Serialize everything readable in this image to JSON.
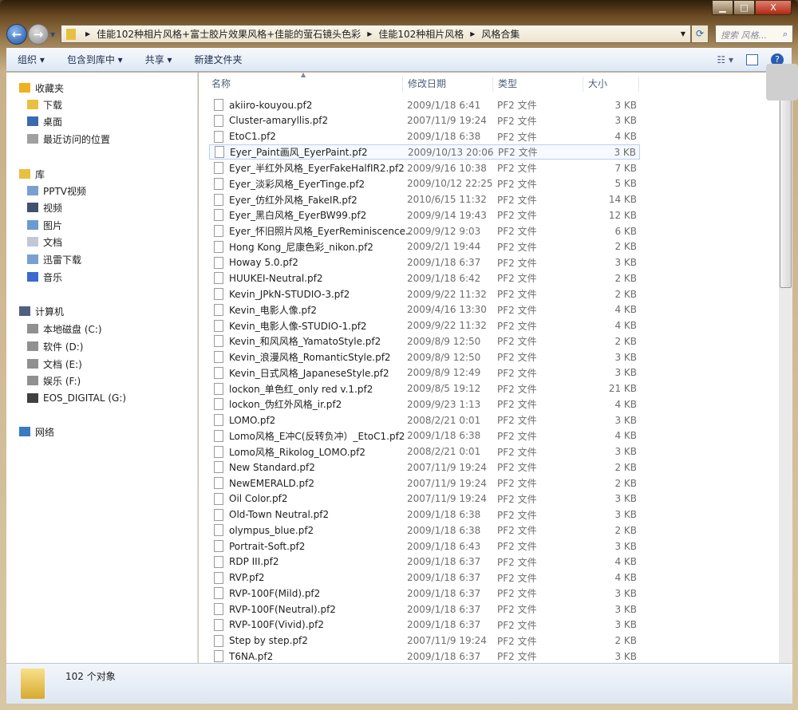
{
  "window": {
    "minimize": "▁",
    "maximize": "□",
    "close": "X"
  },
  "address": {
    "crumbs": [
      "佳能102种相片风格+富士胶片效果风格+佳能的萤石镜头色彩",
      "佳能102种相片风格",
      "风格合集"
    ],
    "search_placeholder": "搜索 风格..."
  },
  "toolbar": {
    "organize": "组织 ▾",
    "include": "包含到库中 ▾",
    "share": "共享 ▾",
    "new_folder": "新建文件夹"
  },
  "sidebar": {
    "items": [
      {
        "label": "收藏夹",
        "indent": 0,
        "color": "#f0b020"
      },
      {
        "label": "下载",
        "indent": 1,
        "color": "#e8c040"
      },
      {
        "label": "桌面",
        "indent": 1,
        "color": "#3a6ab0"
      },
      {
        "label": "最近访问的位置",
        "indent": 1,
        "color": "#a0a0a0"
      },
      {
        "label": "库",
        "indent": 0,
        "color": "#e8c040"
      },
      {
        "label": "PPTV视频",
        "indent": 1,
        "color": "#7aa0d0"
      },
      {
        "label": "视频",
        "indent": 1,
        "color": "#405070"
      },
      {
        "label": "图片",
        "indent": 1,
        "color": "#6a9ad0"
      },
      {
        "label": "文档",
        "indent": 1,
        "color": "#c0c8d8"
      },
      {
        "label": "迅雷下载",
        "indent": 1,
        "color": "#7aa0d0"
      },
      {
        "label": "音乐",
        "indent": 1,
        "color": "#3a6ad0"
      },
      {
        "label": "计算机",
        "indent": 0,
        "color": "#506080"
      },
      {
        "label": "本地磁盘 (C:)",
        "indent": 1,
        "color": "#909090"
      },
      {
        "label": "软件 (D:)",
        "indent": 1,
        "color": "#909090"
      },
      {
        "label": "文档 (E:)",
        "indent": 1,
        "color": "#909090"
      },
      {
        "label": "娱乐 (F:)",
        "indent": 1,
        "color": "#909090"
      },
      {
        "label": "EOS_DIGITAL (G:)",
        "indent": 1,
        "color": "#404040"
      },
      {
        "label": "网络",
        "indent": 0,
        "color": "#3a7ac0"
      }
    ]
  },
  "columns": {
    "name": "名称",
    "date": "修改日期",
    "type": "类型",
    "size": "大小"
  },
  "files": [
    [
      "akiiro-kouyou.pf2",
      "2009/1/18 6:41",
      "3 KB"
    ],
    [
      "Cluster-amaryllis.pf2",
      "2007/11/9 19:24",
      "3 KB"
    ],
    [
      "EtoC1.pf2",
      "2009/1/18 6:38",
      "4 KB"
    ],
    [
      "Eyer_Paint画风_EyerPaint.pf2",
      "2009/10/13 20:06",
      "3 KB"
    ],
    [
      "Eyer_半红外风格_EyerFakeHalfIR2.pf2",
      "2009/9/16 10:38",
      "7 KB"
    ],
    [
      "Eyer_淡彩风格_EyerTinge.pf2",
      "2009/10/12 22:25",
      "5 KB"
    ],
    [
      "Eyer_仿红外风格_FakeIR.pf2",
      "2010/6/15 11:32",
      "14 KB"
    ],
    [
      "Eyer_黑白风格_EyerBW99.pf2",
      "2009/9/14 19:43",
      "12 KB"
    ],
    [
      "Eyer_怀旧照片风格_EyerReminiscence....",
      "2009/9/12 9:03",
      "6 KB"
    ],
    [
      "Hong Kong_尼康色彩_nikon.pf2",
      "2009/2/1 19:44",
      "2 KB"
    ],
    [
      "Howay 5.0.pf2",
      "2009/1/18 6:37",
      "3 KB"
    ],
    [
      "HUUKEI-Neutral.pf2",
      "2009/1/18 6:42",
      "2 KB"
    ],
    [
      "Kevin_JPkN-STUDIO-3.pf2",
      "2009/9/22 11:32",
      "2 KB"
    ],
    [
      "Kevin_电影人像.pf2",
      "2009/4/16 13:30",
      "4 KB"
    ],
    [
      "Kevin_电影人像-STUDIO-1.pf2",
      "2009/9/22 11:32",
      "4 KB"
    ],
    [
      "Kevin_和风风格_YamatoStyle.pf2",
      "2009/8/9 12:50",
      "2 KB"
    ],
    [
      "Kevin_浪漫风格_RomanticStyle.pf2",
      "2009/8/9 12:50",
      "3 KB"
    ],
    [
      "Kevin_日式风格_JapaneseStyle.pf2",
      "2009/8/9 12:49",
      "3 KB"
    ],
    [
      "lockon_单色红_only red v.1.pf2",
      "2009/8/5 19:12",
      "21 KB"
    ],
    [
      "lockon_伪红外风格_ir.pf2",
      "2009/9/23 1:13",
      "4 KB"
    ],
    [
      "LOMO.pf2",
      "2008/2/21 0:01",
      "3 KB"
    ],
    [
      "Lomo风格_E冲C(反转负冲）_EtoC1.pf2",
      "2009/1/18 6:38",
      "4 KB"
    ],
    [
      "Lomo风格_Rikolog_LOMO.pf2",
      "2008/2/21 0:01",
      "3 KB"
    ],
    [
      "New Standard.pf2",
      "2007/11/9 19:24",
      "2 KB"
    ],
    [
      "NewEMERALD.pf2",
      "2007/11/9 19:24",
      "2 KB"
    ],
    [
      "Oil Color.pf2",
      "2007/11/9 19:24",
      "3 KB"
    ],
    [
      "Old-Town Neutral.pf2",
      "2009/1/18 6:38",
      "3 KB"
    ],
    [
      "olympus_blue.pf2",
      "2009/1/18 6:38",
      "2 KB"
    ],
    [
      "Portrait-Soft.pf2",
      "2009/1/18 6:43",
      "3 KB"
    ],
    [
      "RDP III.pf2",
      "2009/1/18 6:37",
      "4 KB"
    ],
    [
      "RVP.pf2",
      "2009/1/18 6:37",
      "4 KB"
    ],
    [
      "RVP-100F(Mild).pf2",
      "2009/1/18 6:37",
      "3 KB"
    ],
    [
      "RVP-100F(Neutral).pf2",
      "2009/1/18 6:37",
      "3 KB"
    ],
    [
      "RVP-100F(Vivid).pf2",
      "2009/1/18 6:37",
      "3 KB"
    ],
    [
      "Step by step.pf2",
      "2007/11/9 19:24",
      "2 KB"
    ],
    [
      "T6NA.pf2",
      "2009/1/18 6:37",
      "3 KB"
    ]
  ],
  "file_type": "PF2 文件",
  "selected_index": 3,
  "status": {
    "count": "102 个对象"
  }
}
